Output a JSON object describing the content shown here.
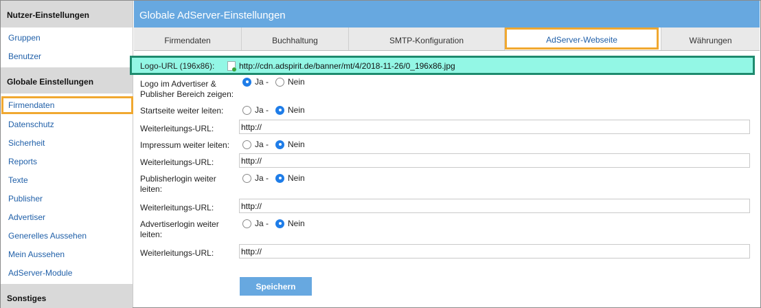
{
  "sidebar": {
    "section1": "Nutzer-Einstellungen",
    "section1_items": [
      "Gruppen",
      "Benutzer"
    ],
    "section2": "Globale Einstellungen",
    "section2_items": [
      "Firmendaten",
      "Datenschutz",
      "Sicherheit",
      "Reports",
      "Texte",
      "Publisher",
      "Advertiser",
      "Generelles Aussehen",
      "Mein Aussehen",
      "AdServer-Module"
    ],
    "section3": "Sonstiges"
  },
  "main": {
    "title": "Globale AdServer-Einstellungen",
    "tabs": [
      "Firmendaten",
      "Buchhaltung",
      "SMTP-Konfiguration",
      "AdServer-Webseite",
      "Währungen"
    ],
    "active_tab": "AdServer-Webseite"
  },
  "form": {
    "logo_label": "Logo-URL (196x86):",
    "logo_url": "http://cdn.adspirit.de/banner/mt/4/2018-11-26/0_196x86.jpg",
    "show_logo_label": "Logo im Advertiser & Publisher Bereich zeigen:",
    "yes": "Ja -",
    "no": "Nein",
    "start_label": "Startseite weiter leiten:",
    "redirect_label": "Weiterleitungs-URL:",
    "redirect_value": "http://",
    "impressum_label": "Impressum weiter leiten:",
    "publisherlogin_label": "Publisherlogin weiter leiten:",
    "advertiserlogin_label": "Advertiserlogin weiter leiten:",
    "save": "Speichern"
  },
  "colors": {
    "accent": "#67a8e0",
    "highlight": "#f0a830",
    "logo_highlight": "#93f7e5",
    "link": "#1f5fa8"
  }
}
